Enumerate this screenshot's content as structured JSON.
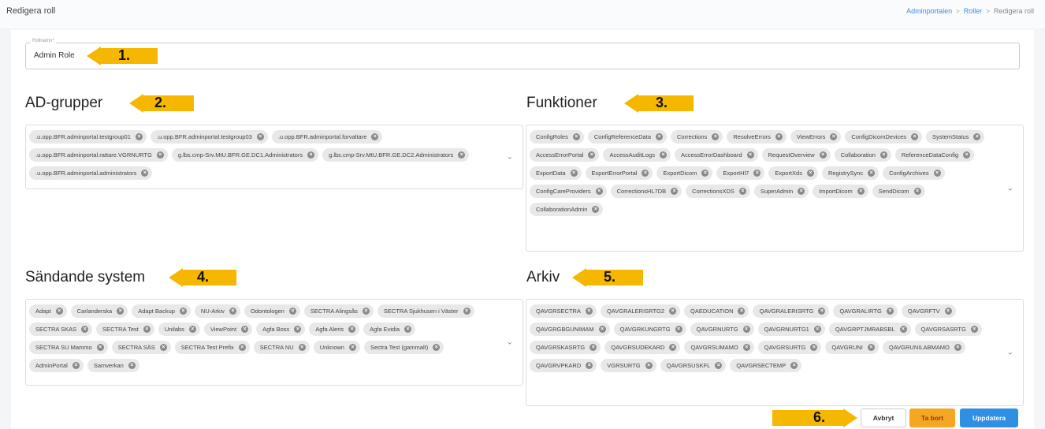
{
  "header": {
    "title": "Redigera roll",
    "breadcrumb": [
      "Adminportalen",
      "Roller",
      "Redigera roll"
    ]
  },
  "role_name": {
    "label": "Rollnamn*",
    "value": "Admin Role"
  },
  "sections": {
    "ad_groups": {
      "title": "AD-grupper",
      "items": [
        ".u.opp.BFR.adminportal.testgroup01",
        ".u.opp.BFR.adminportal.testgroup03",
        ".u.opp.BFR.adminportal.forvaltare",
        ".u.opp.BFR.adminportal.rattare.VGRNURTG",
        "g.lbs.cmp-Srv.MtU.BFR.GE.DC1.Administrators",
        "g.lbs.cmp-Srv.MtU.BFR.GE.DC2.Administrators",
        ".u.opp.BFR.adminportal.administrators"
      ]
    },
    "functions": {
      "title": "Funktioner",
      "items": [
        "ConfigRoles",
        "ConfigReferenceData",
        "Corrections",
        "ResolveErrors",
        "ViewErrors",
        "ConfigDicomDevices",
        "SystemStatus",
        "AccessErrorPortal",
        "AccessAuditLogs",
        "AccessErrorDashboard",
        "RequestOverview",
        "Collaboration",
        "ReferenceDataConfig",
        "ExportData",
        "ExportErrorPortal",
        "ExportDicom",
        "ExportHl7",
        "ExportXds",
        "RegistrySync",
        "ConfigArchives",
        "ConfigCareProviders",
        "CorrectionsHL7DB",
        "CorrectionsXDS",
        "SuperAdmin",
        "ImportDicom",
        "SendDicom",
        "CollaborationAdmin"
      ]
    },
    "sending_systems": {
      "title": "Sändande system",
      "items": [
        "Adapt",
        "Carlanderska",
        "Adapt Backup",
        "NU-Arkiv",
        "Odontologen",
        "SECTRA Alingsås",
        "SECTRA Sjukhusen i Väster",
        "SECTRA SKAS",
        "SECTRA Test",
        "Unilabs",
        "ViewPoint",
        "Agfa Boss",
        "Agfa Aleris",
        "Agfa Evidia",
        "SECTRA SU Mammo",
        "SECTRA SÄS",
        "SECTRA Test Prefix",
        "SECTRA NU",
        "Unknown",
        "Sectra Test (gammalt)",
        "AdminPortal",
        "Samverkan"
      ]
    },
    "archives": {
      "title": "Arkiv",
      "items": [
        "QAVGRSECTRA",
        "QAVGRALERISRTG2",
        "QAEDUCATION",
        "QAVGRALERISRTG",
        "QAVGRALIRTG",
        "QAVGRFTV",
        "QAVGRGBGUNIMAM",
        "QAVGRKUNGRTG",
        "QAVGRNURTG",
        "QAVGRNURTG1",
        "QAVGRPTJMRABSBL",
        "QAVGRSASRTG",
        "QAVGRSKASRTG",
        "QAVGRSUDEKARD",
        "QAVGRSUMAMO",
        "QAVGRSURTG",
        "QAVGRUNI",
        "QAVGRUNILABMAMO",
        "QAVGRVPKARD",
        "VGRSURTG",
        "QAVGRSUSKFL",
        "QAVGRSECTEMP"
      ]
    }
  },
  "markers": [
    "1.",
    "2.",
    "3.",
    "4.",
    "5.",
    "6."
  ],
  "buttons": {
    "cancel": "Avbryt",
    "delete": "Ta bort",
    "update": "Uppdatera"
  },
  "colors": {
    "accent": "#2f8fe3",
    "warning": "#f5a623",
    "annotation": "#f5b700"
  }
}
